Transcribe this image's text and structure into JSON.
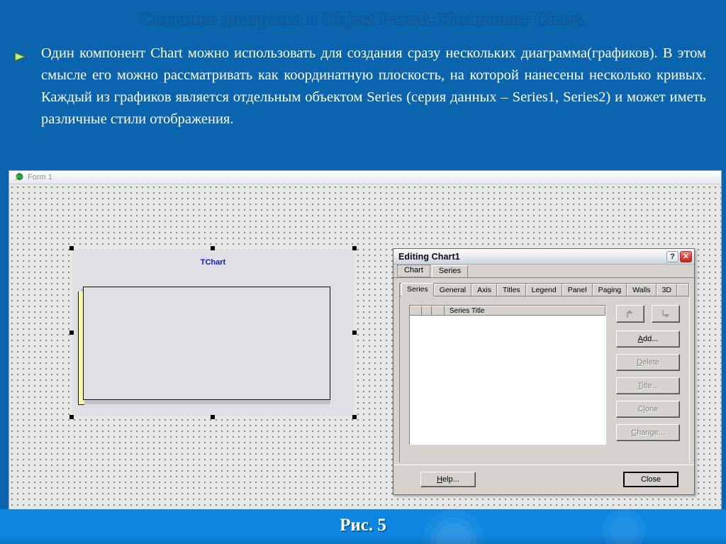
{
  "slide": {
    "title": "Создание диаграмм в Object Pascal. Компонент Chart.",
    "bullet_icon": "green-arrow-bullet-icon",
    "body_text": "Один компонент Chart можно использовать для создания сразу нескольких диаграмма(графиков). В этом смысле его можно рассматривать как координатную плоскость, на которой нанесены несколько кривых. Каждый из графиков является отдельным объектом Series (серия данных – Series1, Series2) и может иметь различные стили отображения.",
    "footer_caption": "Рис. 5",
    "colors": {
      "slide_background": "#0A64AE",
      "footer_background": "#0C86E0",
      "title_text": "#0A64AE",
      "body_text": "#FFFFFF",
      "tchart_caption": "#1515D6",
      "chart_left_wall": "#FAF9A8"
    }
  },
  "form_window": {
    "icon": "delphi-form-icon",
    "title": "Form 1",
    "component": {
      "caption": "TChart",
      "selected": true
    }
  },
  "dialog": {
    "title": "Editing Chart1",
    "titlebar_buttons": [
      {
        "name": "help-button",
        "glyph": "?"
      },
      {
        "name": "close-button",
        "glyph": "✕"
      }
    ],
    "outer_tabs": [
      {
        "label": "Chart",
        "active": true
      },
      {
        "label": "Series",
        "active": false
      }
    ],
    "inner_tabs": [
      {
        "label": "Series",
        "active": true
      },
      {
        "label": "General",
        "active": false
      },
      {
        "label": "Axis",
        "active": false
      },
      {
        "label": "Titles",
        "active": false
      },
      {
        "label": "Legend",
        "active": false
      },
      {
        "label": "Panel",
        "active": false
      },
      {
        "label": "Paging",
        "active": false
      },
      {
        "label": "Walls",
        "active": false
      },
      {
        "label": "3D",
        "active": false
      }
    ],
    "series_list": {
      "columns": [
        "",
        "",
        "",
        "Series Title"
      ],
      "rows": []
    },
    "side_buttons": [
      {
        "name": "move-up-button",
        "label": "",
        "icon": "arrow-up-icon",
        "enabled": false
      },
      {
        "name": "move-down-button",
        "label": "",
        "icon": "arrow-down-icon",
        "enabled": false
      },
      {
        "name": "add-button",
        "label": "Add...",
        "accel": "A",
        "enabled": true
      },
      {
        "name": "delete-button",
        "label": "Delete",
        "accel": "D",
        "enabled": false
      },
      {
        "name": "title-button",
        "label": "Title...",
        "accel": "T",
        "enabled": false
      },
      {
        "name": "clone-button",
        "label": "Clone",
        "accel": "l",
        "enabled": false
      },
      {
        "name": "change-button",
        "label": "Change...",
        "accel": "C",
        "enabled": false
      }
    ],
    "footer_buttons": [
      {
        "name": "help-button",
        "label": "Help...",
        "default": false
      },
      {
        "name": "close-button",
        "label": "Close",
        "default": true
      }
    ]
  }
}
